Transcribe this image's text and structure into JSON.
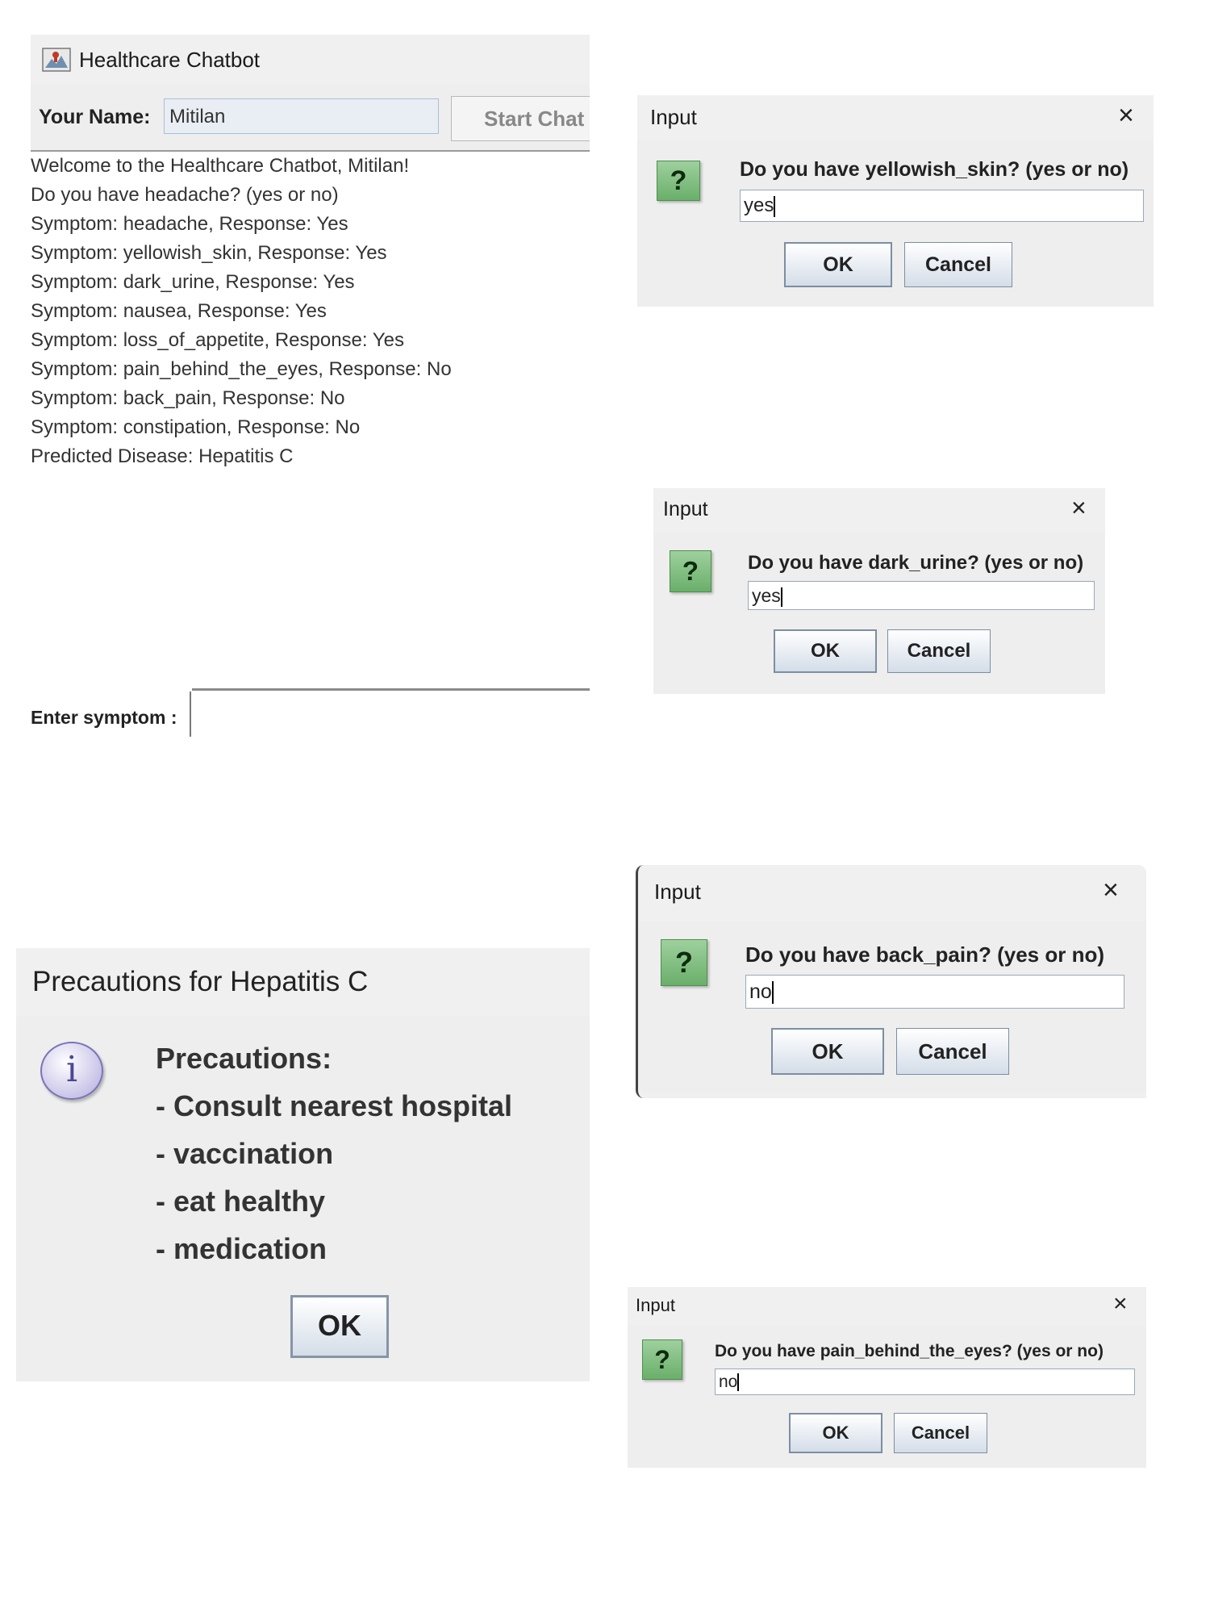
{
  "main_window": {
    "title": "Healthcare Chatbot",
    "name_label": "Your Name:",
    "name_value": "Mitilan",
    "start_button": "Start Chat",
    "chat_lines": [
      "Welcome to the Healthcare Chatbot, Mitilan!",
      "Do you have headache? (yes or no)",
      "Symptom: headache, Response: Yes",
      "Symptom: yellowish_skin, Response: Yes",
      "Symptom: dark_urine, Response: Yes",
      "Symptom: nausea, Response: Yes",
      "Symptom: loss_of_appetite, Response: Yes",
      "Symptom: pain_behind_the_eyes, Response: No",
      "Symptom: back_pain, Response: No",
      "Symptom: constipation, Response: No",
      "Predicted Disease: Hepatitis C"
    ],
    "symptom_label": "Enter symptom :",
    "symptom_value": ""
  },
  "dialogs": [
    {
      "title": "Input",
      "close": "×",
      "question": "Do you have yellowish_skin? (yes or no)",
      "value": "yes",
      "ok": "OK",
      "cancel": "Cancel"
    },
    {
      "title": "Input",
      "close": "×",
      "question": "Do you have dark_urine? (yes or no)",
      "value": "yes",
      "ok": "OK",
      "cancel": "Cancel"
    },
    {
      "title": "Input",
      "close": "×",
      "question": "Do you have back_pain? (yes or no)",
      "value": "no",
      "ok": "OK",
      "cancel": "Cancel"
    },
    {
      "title": "Input",
      "close": "×",
      "question": "Do you have pain_behind_the_eyes? (yes or no)",
      "value": "no",
      "ok": "OK",
      "cancel": "Cancel"
    }
  ],
  "precautions": {
    "title": "Precautions for Hepatitis C",
    "icon_glyph": "i",
    "lines": [
      "Precautions:",
      "- Consult nearest hospital",
      "- vaccination",
      "- eat healthy",
      "- medication"
    ],
    "ok": "OK"
  },
  "icons": {
    "app": "healthcare-app-icon",
    "question": "question-icon",
    "info": "info-icon",
    "close": "close-icon"
  },
  "colors": {
    "question_icon": "#7fbf7f",
    "info_icon": "#c9c4e8",
    "button_border": "#7c8ea3"
  }
}
